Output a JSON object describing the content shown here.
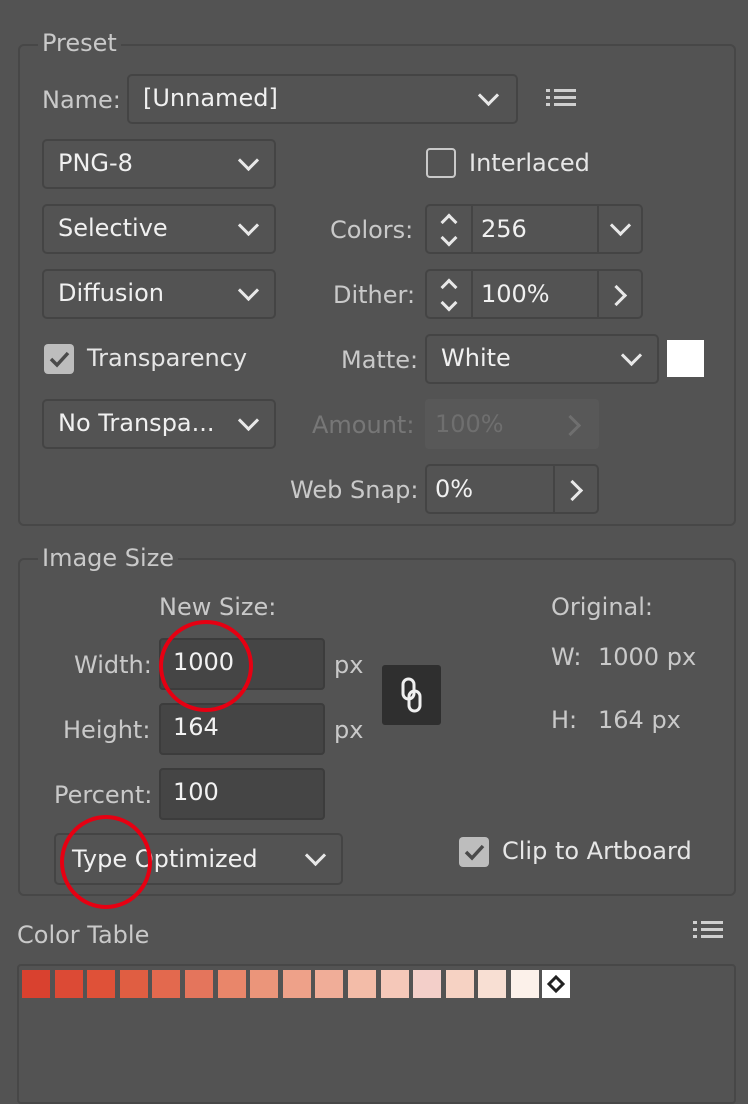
{
  "preset": {
    "legend": "Preset",
    "name_label": "Name:",
    "name_value": "[Unnamed]",
    "format": "PNG-8",
    "interlaced_label": "Interlaced",
    "interlaced": false,
    "color_reduction": "Selective",
    "colors_label": "Colors:",
    "colors_value": "256",
    "dither_algorithm": "Diffusion",
    "dither_label": "Dither:",
    "dither_value": "100%",
    "transparency_label": "Transparency",
    "transparency": true,
    "matte_label": "Matte:",
    "matte_value": "White",
    "matte_color": "#ffffff",
    "transparency_dither": "No Transpa...",
    "amount_label": "Amount:",
    "amount_value": "100%",
    "websnap_label": "Web Snap:",
    "websnap_value": "0%"
  },
  "image_size": {
    "legend": "Image Size",
    "new_size_label": "New Size:",
    "width_label": "Width:",
    "width_value": "1000",
    "height_label": "Height:",
    "height_value": "164",
    "percent_label": "Percent:",
    "percent_value": "100",
    "unit": "px",
    "original_label": "Original:",
    "orig_w_label": "W:",
    "orig_w_value": "1000 px",
    "orig_h_label": "H:",
    "orig_h_value": "164 px",
    "quality": "Type Optimized",
    "clip_label": "Clip to Artboard",
    "clip": true
  },
  "color_table": {
    "title": "Color Table",
    "colors": [
      "#d9412f",
      "#dc4a35",
      "#df5138",
      "#e05e42",
      "#e3694e",
      "#e4755c",
      "#e9866a",
      "#eb957a",
      "#ee a189",
      "#f0ad98",
      "#f3bca8",
      "#f5c8b9",
      "#f3cfc9",
      "#f6d2c3",
      "#f8dfd3",
      "#fcf1ea"
    ]
  }
}
